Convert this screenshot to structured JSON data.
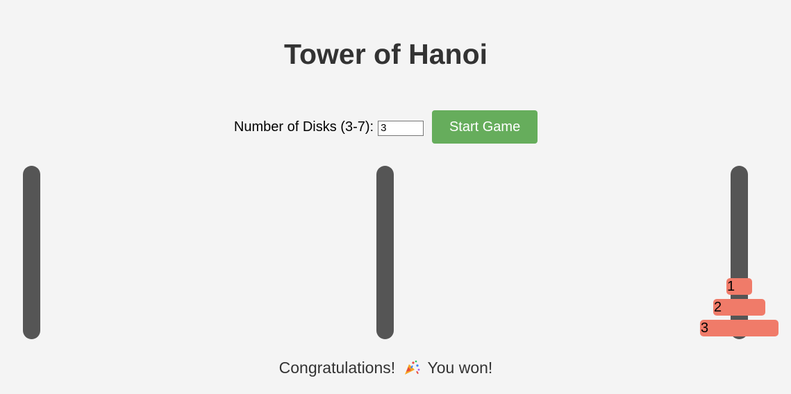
{
  "title": "Tower of Hanoi",
  "controls": {
    "disk_count_label": "Number of Disks (3-7):",
    "disk_count_value": "3",
    "start_button_label": "Start Game"
  },
  "towers": [
    {
      "disks": []
    },
    {
      "disks": []
    },
    {
      "disks": [
        "1",
        "2",
        "3"
      ]
    }
  ],
  "message": {
    "before": "Congratulations!",
    "icon": "party-popper-icon",
    "after": "You won!"
  },
  "colors": {
    "background": "#f4f4f4",
    "peg": "#555555",
    "disk": "#f07b69",
    "start_button": "#66ad5c",
    "text": "#333333"
  }
}
